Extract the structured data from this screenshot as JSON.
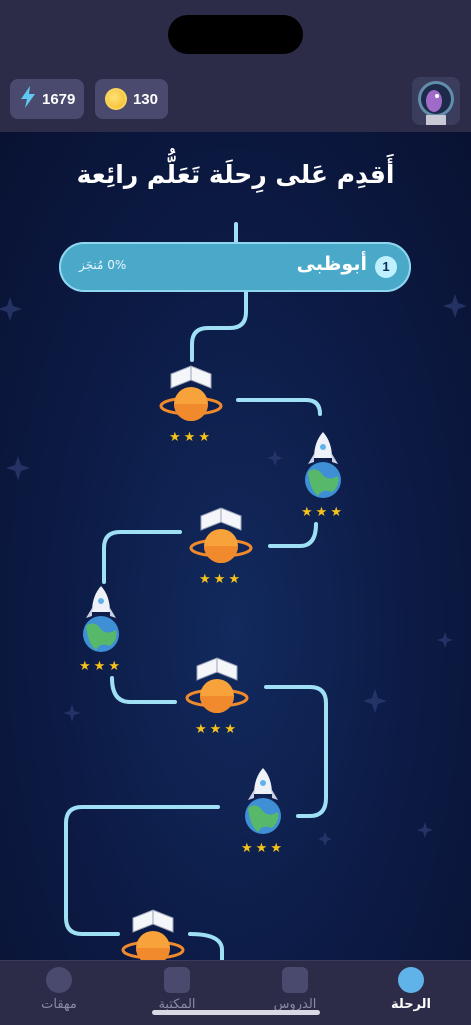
{
  "status": {
    "energy": "1679",
    "coins": "130"
  },
  "headline": "أَقدِم عَلى رِحلَة تَعَلُّم رائِعة",
  "unit": {
    "number": "1",
    "name": "أبوظبى",
    "progress": "0% مُنجَز"
  },
  "nodes": [
    {
      "type": "planet-book",
      "stars": "★★★"
    },
    {
      "type": "rocket-earth",
      "stars": "★★★"
    },
    {
      "type": "planet-book",
      "stars": "★★★"
    },
    {
      "type": "rocket-earth",
      "stars": "★★★"
    },
    {
      "type": "planet-book",
      "stars": "★★★"
    },
    {
      "type": "rocket-earth",
      "stars": "★★★"
    },
    {
      "type": "planet-book",
      "stars": ""
    }
  ],
  "tabs": [
    {
      "label": "الرحلة",
      "icon": "journey-icon",
      "active": true
    },
    {
      "label": "الدروس",
      "icon": "lessons-icon",
      "active": false
    },
    {
      "label": "المكتبة",
      "icon": "library-icon",
      "active": false
    },
    {
      "label": "مهقات",
      "icon": "missions-icon",
      "active": false
    }
  ],
  "colors": {
    "path": "#9fe0f5",
    "unit_bar": "#4aa8c9",
    "star": "#f6c21c",
    "background": "#0b1334"
  }
}
